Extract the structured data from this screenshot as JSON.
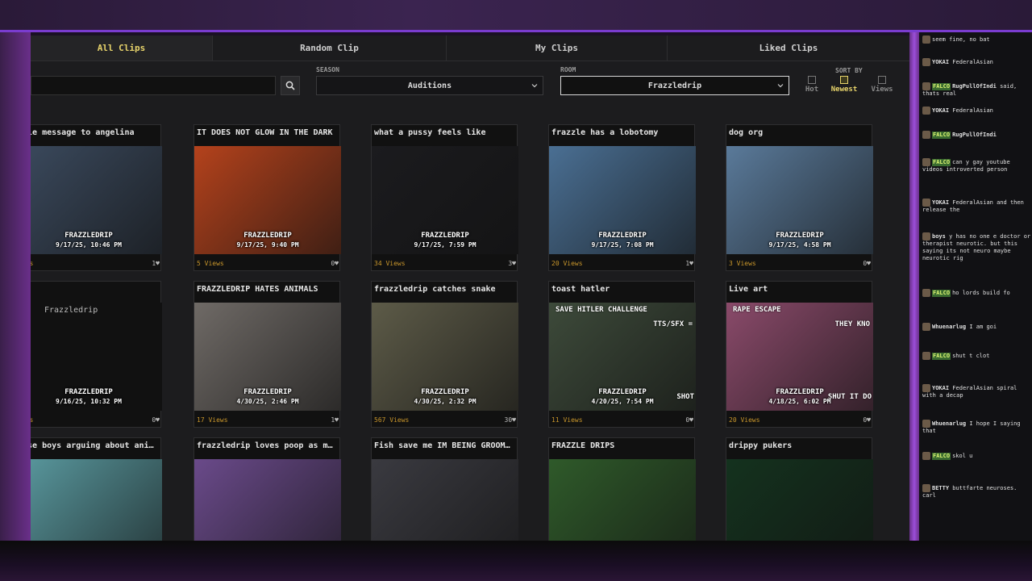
{
  "tabs": [
    {
      "label": "All Clips",
      "active": true
    },
    {
      "label": "Random Clip",
      "active": false
    },
    {
      "label": "My Clips",
      "active": false
    },
    {
      "label": "Liked Clips",
      "active": false
    }
  ],
  "filters": {
    "search_placeholder": "",
    "season_label": "SEASON",
    "season_value": "Auditions",
    "room_label": "ROOM",
    "room_value": "Frazzledrip",
    "sort_label": "SORT BY",
    "sort_options": [
      {
        "label": "Hot",
        "checked": false
      },
      {
        "label": "Newest",
        "checked": true
      },
      {
        "label": "Views",
        "checked": false
      }
    ]
  },
  "clips": [
    {
      "title": "zzle message to angelina",
      "room": "FRAZZLEDRIP",
      "date": "9/17/25, 10:46 PM",
      "views": "iews",
      "likes": "1",
      "thumb_color": "#3b4a5e"
    },
    {
      "title": "IT DOES NOT GLOW IN THE DARK",
      "room": "FRAZZLEDRIP",
      "date": "9/17/25, 9:40 PM",
      "views": "5 Views",
      "likes": "0",
      "thumb_color": "#b4421c"
    },
    {
      "title": "what a pussy feels like",
      "room": "FRAZZLEDRIP",
      "date": "9/17/25, 7:59 PM",
      "views": "34 Views",
      "likes": "3",
      "thumb_color": "#1b1b1e"
    },
    {
      "title": "frazzle has a lobotomy",
      "room": "FRAZZLEDRIP",
      "date": "9/17/25, 7:08 PM",
      "views": "20 Views",
      "likes": "1",
      "thumb_color": "#4a6f93"
    },
    {
      "title": "dog org",
      "room": "FRAZZLEDRIP",
      "date": "9/17/25, 4:58 PM",
      "views": "3 Views",
      "likes": "0",
      "thumb_color": "#5a7a9a"
    },
    {
      "title": "on",
      "room": "FRAZZLEDRIP",
      "date": "9/16/25, 10:32 PM",
      "views": "iews",
      "likes": "0",
      "thumb_color": "#111111",
      "broken_text": "Frazzledrip"
    },
    {
      "title": "FRAZZLEDRIP HATES ANIMALS",
      "room": "FRAZZLEDRIP",
      "date": "4/30/25, 2:46 PM",
      "views": "17 Views",
      "likes": "1",
      "thumb_color": "#6f6a66"
    },
    {
      "title": "frazzledrip catches snake",
      "room": "FRAZZLEDRIP",
      "date": "4/30/25, 2:32 PM",
      "views": "567 Views",
      "likes": "30",
      "thumb_color": "#5d5b48"
    },
    {
      "title": "toast hatler",
      "room": "FRAZZLEDRIP",
      "date": "4/20/25, 7:54 PM",
      "views": "11 Views",
      "likes": "0",
      "thumb_color": "#3d4a3a",
      "thumb_texts": [
        "SAVE HITLER CHALLENGE",
        "TTS/SFX =",
        "SHOT"
      ]
    },
    {
      "title": "Live art",
      "room": "FRAZZLEDRIP",
      "date": "4/18/25, 6:02 PM",
      "views": "20 Views",
      "likes": "0",
      "thumb_color": "#8a4a6a",
      "thumb_texts": [
        "RAPE ESCAPE",
        "THEY KNO",
        "SHUT IT DO"
      ]
    },
    {
      "title": "nese boys arguing about anime...",
      "room": "",
      "date": "",
      "views": "",
      "likes": "",
      "thumb_color": "#5a9aa0"
    },
    {
      "title": "frazzledrip loves poop as much a...",
      "room": "",
      "date": "",
      "views": "",
      "likes": "",
      "thumb_color": "#6a4a8a"
    },
    {
      "title": "Fish save me IM BEING GROOMED",
      "room": "",
      "date": "",
      "views": "",
      "likes": "",
      "thumb_color": "#3a3a40"
    },
    {
      "title": "FRAZZLE DRIPS",
      "room": "",
      "date": "",
      "views": "",
      "likes": "",
      "thumb_color": "#2f5a2a"
    },
    {
      "title": "drippy pukers",
      "room": "",
      "date": "",
      "views": "",
      "likes": "",
      "thumb_color": "#14321e"
    }
  ],
  "chat": [
    {
      "user": "",
      "badge": "",
      "text": "seem fine, no bat"
    },
    {
      "user": "YOKAI",
      "badge": "",
      "text": "FederalAsian"
    },
    {
      "user": "RugPullOfIndi",
      "badge": "FALCO",
      "text": "said, thats real"
    },
    {
      "user": "YOKAI",
      "badge": "",
      "text": "FederalAsian"
    },
    {
      "user": "RugPullOfIndi",
      "badge": "FALCO",
      "text": ""
    },
    {
      "user": "",
      "badge": "FALCO",
      "text": "can y gay youtube videos introverted person"
    },
    {
      "user": "YOKAI",
      "badge": "",
      "text": "FederalAsian and then release the"
    },
    {
      "user": "boys",
      "badge": "",
      "text": "y has no one e doctor or therapist neurotic. but this saying its not neuro maybe neurotic rig"
    },
    {
      "user": "",
      "badge": "FALCO",
      "text": "ho lords build fo"
    },
    {
      "user": "Whuenarlug",
      "badge": "",
      "text": "I am goi"
    },
    {
      "user": "",
      "badge": "FALCO",
      "text": "shut t clot"
    },
    {
      "user": "YOKAI",
      "badge": "",
      "text": "FederalAsian spiral with a decap"
    },
    {
      "user": "Whuenarlug",
      "badge": "",
      "text": "I hope I saying that"
    },
    {
      "user": "",
      "badge": "FALCO",
      "text": "skol u"
    },
    {
      "user": "BETTY",
      "badge": "",
      "text": "buttfarte neuroses. carl"
    }
  ]
}
